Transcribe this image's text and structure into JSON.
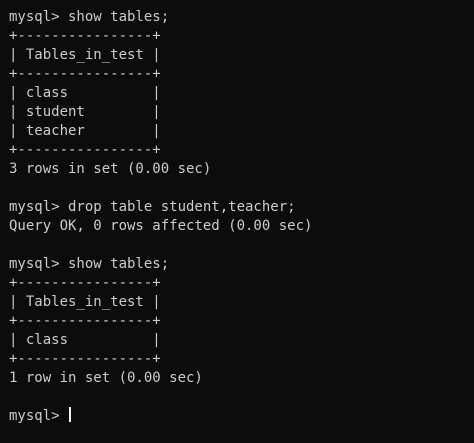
{
  "terminal": {
    "lines": [
      "mysql> show tables;",
      "+----------------+",
      "| Tables_in_test |",
      "+----------------+",
      "| class          |",
      "| student        |",
      "| teacher        |",
      "+----------------+",
      "3 rows in set (0.00 sec)",
      "",
      "mysql> drop table student,teacher;",
      "Query OK, 0 rows affected (0.00 sec)",
      "",
      "mysql> show tables;",
      "+----------------+",
      "| Tables_in_test |",
      "+----------------+",
      "| class          |",
      "+----------------+",
      "1 row in set (0.00 sec)",
      ""
    ],
    "prompt": "mysql> "
  },
  "colors": {
    "background": "#0c0c0c",
    "text": "#cccccc",
    "cursor": "#f2f2f2"
  }
}
